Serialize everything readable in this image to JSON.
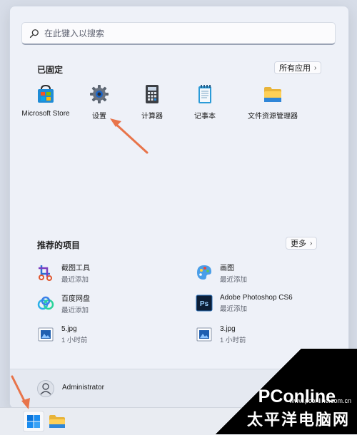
{
  "search": {
    "placeholder": "在此键入以搜索"
  },
  "pinned": {
    "title": "已固定",
    "all_apps_label": "所有应用",
    "apps": [
      {
        "label": "Microsoft Store",
        "icon": "store-icon"
      },
      {
        "label": "设置",
        "icon": "settings-gear-icon"
      },
      {
        "label": "计算器",
        "icon": "calculator-icon"
      },
      {
        "label": "记事本",
        "icon": "notepad-icon"
      },
      {
        "label": "文件资源管理器",
        "icon": "folder-icon"
      }
    ]
  },
  "recommended": {
    "title": "推荐的项目",
    "more_label": "更多",
    "items": [
      {
        "name": "截图工具",
        "sub": "最近添加",
        "icon": "snipping-tool-icon"
      },
      {
        "name": "画图",
        "sub": "最近添加",
        "icon": "paint-icon"
      },
      {
        "name": "百度网盘",
        "sub": "最近添加",
        "icon": "baidu-netdisk-icon"
      },
      {
        "name": "Adobe Photoshop CS6",
        "sub": "最近添加",
        "icon": "photoshop-icon"
      },
      {
        "name": "5.jpg",
        "sub": "1 小时前",
        "icon": "image-file-icon"
      },
      {
        "name": "3.jpg",
        "sub": "1 小时前",
        "icon": "image-file-icon"
      }
    ]
  },
  "user": {
    "name": "Administrator"
  },
  "watermark": {
    "brand": "PConline",
    "sub": "太平洋电脑网",
    "url": "www.pconline.com.cn"
  },
  "colors": {
    "accent": "#0067c0",
    "arrow": "#e8744a"
  }
}
